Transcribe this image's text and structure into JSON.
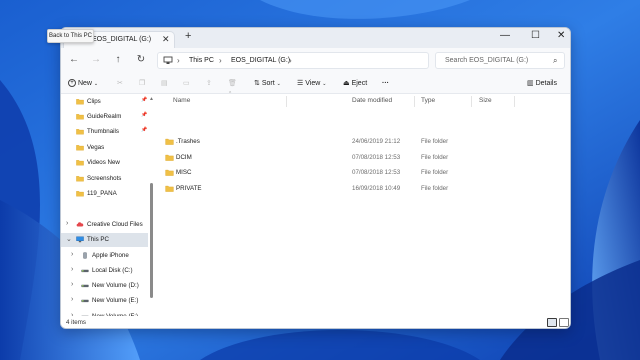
{
  "colors": {
    "accent": "#1c63d6",
    "folder": "#f0c046",
    "selection": "#dde3ea"
  },
  "tooltip": {
    "text": "Back to This PC"
  },
  "titlebar": {
    "tab_title": "EOS_DIGITAL (G:)",
    "tab_close": "✕",
    "new_tab": "+",
    "minimize": "—",
    "maximize": "☐",
    "close": "✕"
  },
  "address": {
    "back_icon": "←",
    "forward_icon": "→",
    "up_icon": "↑",
    "refresh_icon": "↻",
    "crumbs": [
      "This PC",
      "EOS_DIGITAL (G:)"
    ],
    "sep": "›",
    "search_placeholder": "Search EOS_DIGITAL (G:)",
    "search_icon": "⌕"
  },
  "toolbar": {
    "new_label": "New",
    "sort_label": "Sort",
    "view_label": "View",
    "eject_label": "Eject",
    "more_label": "···",
    "details_label": "Details"
  },
  "sidebar": {
    "items": [
      {
        "label": "Clips",
        "icon": "folder-icon",
        "pinned": true
      },
      {
        "label": "GuideRealm",
        "icon": "folder-icon",
        "pinned": true
      },
      {
        "label": "Thumbnails",
        "icon": "folder-icon",
        "pinned": true
      },
      {
        "label": "Vegas",
        "icon": "folder-icon",
        "pinned": false
      },
      {
        "label": "Videos New",
        "icon": "folder-icon",
        "pinned": false
      },
      {
        "label": "Screenshots",
        "icon": "folder-icon",
        "pinned": false
      },
      {
        "label": "119_PANA",
        "icon": "folder-icon",
        "pinned": false
      },
      {
        "label": "Creative Cloud Files",
        "icon": "cloud-icon",
        "pinned": false
      },
      {
        "label": "This PC",
        "icon": "computer-icon",
        "pinned": false
      },
      {
        "label": "Apple iPhone",
        "icon": "phone-icon",
        "pinned": false
      },
      {
        "label": "Local Disk (C:)",
        "icon": "drive-icon",
        "pinned": false
      },
      {
        "label": "New Volume (D:)",
        "icon": "drive-icon",
        "pinned": false
      },
      {
        "label": "New Volume (E:)",
        "icon": "drive-icon",
        "pinned": false
      },
      {
        "label": "New Volume (F:)",
        "icon": "drive-icon",
        "pinned": false
      }
    ]
  },
  "content": {
    "columns": [
      "Name",
      "Date modified",
      "Type",
      "Size"
    ],
    "rows": [
      {
        "name": ".Trashes",
        "date": "24/06/2019 21:12",
        "type": "File folder"
      },
      {
        "name": "DCIM",
        "date": "07/08/2018 12:53",
        "type": "File folder"
      },
      {
        "name": "MISC",
        "date": "07/08/2018 12:53",
        "type": "File folder"
      },
      {
        "name": "PRIVATE",
        "date": "16/09/2018 10:49",
        "type": "File folder"
      }
    ]
  },
  "status": {
    "items_count": "4 items"
  }
}
